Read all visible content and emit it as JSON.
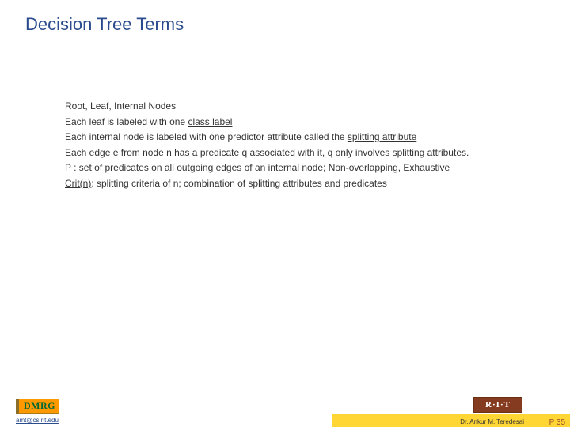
{
  "title": "Decision Tree Terms",
  "lines": [
    {
      "html": "Root, Leaf, Internal Nodes"
    },
    {
      "html": "Each leaf is labeled with one <span class='u'>class label</span>"
    },
    {
      "html": "Each internal node is labeled with one predictor attribute called the <span class='u'>splitting attribute</span>"
    },
    {
      "html": "Each edge <span class='u'>e</span> from node n has a <span class='u'>predicate q</span> associated with it, q only involves splitting attributes."
    },
    {
      "html": "<span class='u'>P :</span> set of predicates on all outgoing edges of an internal node; Non-overlapping, Exhaustive"
    },
    {
      "html": "<span class='u'>Crit(n)</span>: splitting criteria of n; combination of splitting attributes and predicates"
    }
  ],
  "footer": {
    "dmrg": "DMRG",
    "email": "amt@cs.rit.edu",
    "ritLogo": "R·I·T",
    "author": "Dr. Ankur M. Teredesai",
    "pagenum": "P 35"
  }
}
